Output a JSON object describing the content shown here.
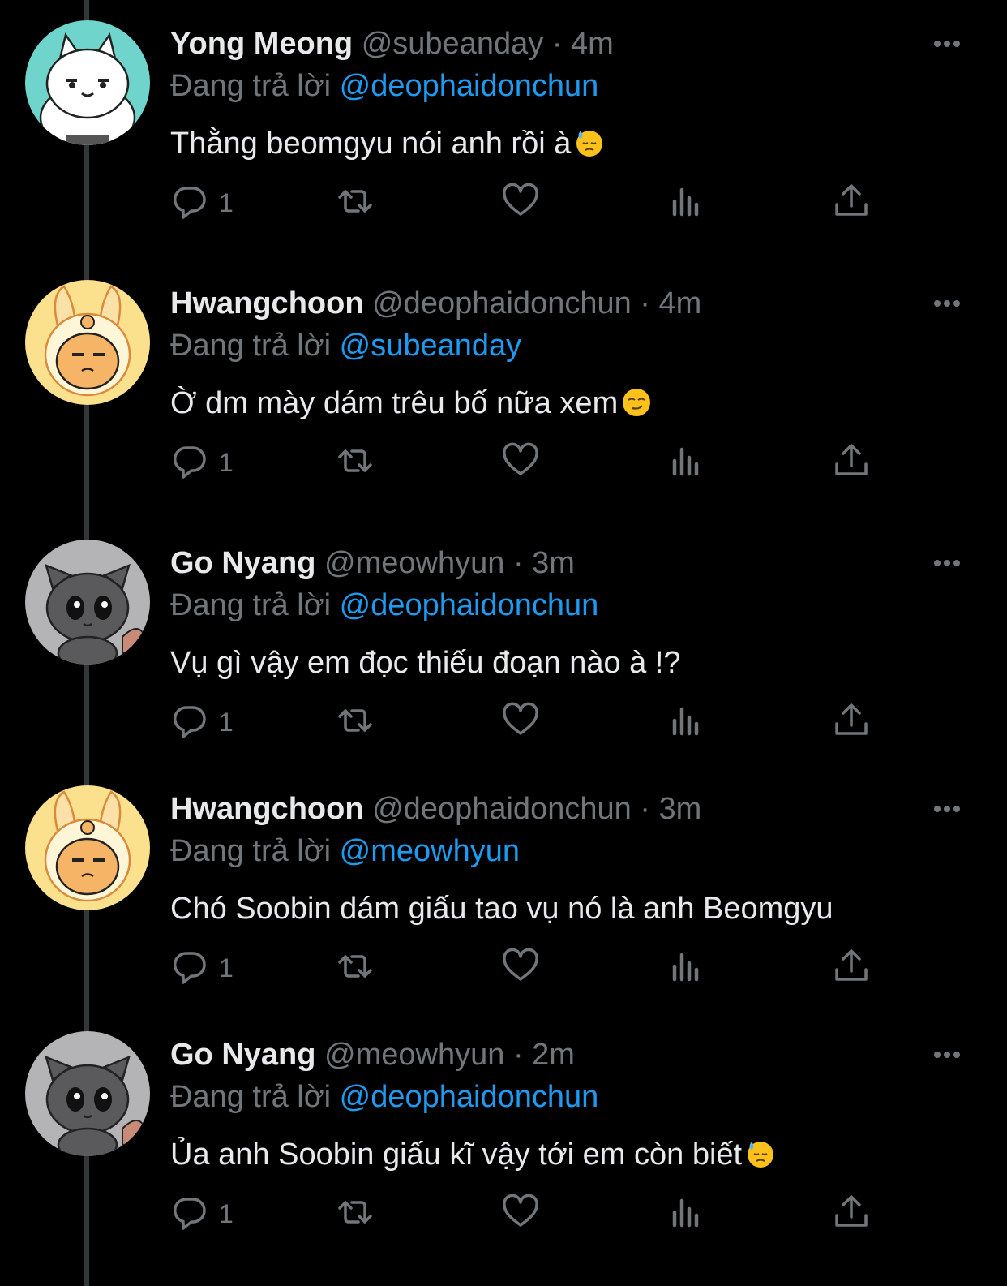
{
  "app": {
    "replying_prefix": "Đang trả lời",
    "separator": "·"
  },
  "tweets": [
    {
      "display_name": "Yong Meong",
      "handle": "@subeanday",
      "time": "4m",
      "replying_to": "@deophaidonchun",
      "text": "Thằng beomgyu nói anh rồi à",
      "emoji": "downcast-face-with-sweat-emoji",
      "reply_count": "1",
      "avatar": "white-dog-avatar"
    },
    {
      "display_name": "Hwangchoon",
      "handle": "@deophaidonchun",
      "time": "4m",
      "replying_to": "@subeanday",
      "text": "Ờ dm mày dám trêu bố nữa xem",
      "emoji": "smirking-face-emoji",
      "reply_count": "1",
      "avatar": "bunny-hood-avatar"
    },
    {
      "display_name": "Go Nyang",
      "handle": "@meowhyun",
      "time": "3m",
      "replying_to": "@deophaidonchun",
      "text": "Vụ gì vậy em đọc thiếu đoạn nào à !?",
      "emoji": "",
      "reply_count": "1",
      "avatar": "gray-cat-avatar"
    },
    {
      "display_name": "Hwangchoon",
      "handle": "@deophaidonchun",
      "time": "3m",
      "replying_to": "@meowhyun",
      "text": "Chó Soobin dám giấu tao vụ nó là anh Beomgyu",
      "emoji": "",
      "reply_count": "1",
      "avatar": "bunny-hood-avatar"
    },
    {
      "display_name": "Go Nyang",
      "handle": "@meowhyun",
      "time": "2m",
      "replying_to": "@deophaidonchun",
      "text": "Ủa anh Soobin giấu kĩ vậy tới em còn biết",
      "emoji": "downcast-face-with-sweat-emoji",
      "reply_count": "1",
      "avatar": "gray-cat-avatar"
    }
  ],
  "icons": {
    "reply": "reply-icon",
    "retweet": "retweet-icon",
    "like": "like-icon",
    "views": "views-icon",
    "share": "share-icon",
    "more": "more-icon"
  },
  "colors": {
    "background": "#000000",
    "text_primary": "#e7e9ea",
    "text_secondary": "#71767b",
    "accent": "#1d9bf0",
    "thread_line": "#333639"
  }
}
